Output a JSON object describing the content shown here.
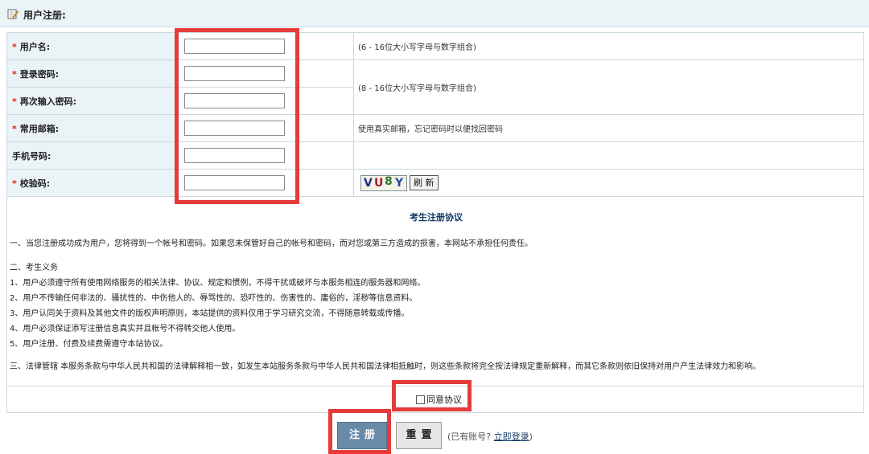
{
  "header": {
    "title": "用户注册:",
    "icon": "edit-icon"
  },
  "form": {
    "username": {
      "label": "用户名:",
      "required": true,
      "value": "",
      "hint": "(6 - 16位大小写字母与数字组合)"
    },
    "password": {
      "label": "登录密码:",
      "required": true,
      "value": "",
      "hint": "(8 - 16位大小写字母与数字组合)"
    },
    "password_confirm": {
      "label": "再次输入密码:",
      "required": true,
      "value": ""
    },
    "email": {
      "label": "常用邮箱:",
      "required": true,
      "value": "",
      "hint": "使用真实邮箱，忘记密码时以便找回密码"
    },
    "phone": {
      "label": "手机号码:",
      "required": false,
      "value": ""
    },
    "captcha": {
      "label": "校验码:",
      "required": true,
      "value": "",
      "image_text": "VU8Y",
      "refresh_label": "刷 新"
    },
    "required_mark": "*"
  },
  "agreement": {
    "title": "考生注册协议",
    "para1": "一、当您注册成功成为用户，您将得到一个帐号和密码。如果您未保管好自己的帐号和密码，而对您或第三方造成的损害，本网站不承担任何责任。",
    "section2_title": "二、考生义务",
    "items": [
      "1、用户必须遵守所有使用网络服务的相关法律、协议、规定和惯例，不得干扰或破坏与本服务相连的服务器和网络。",
      "2、用户不传输任何非法的、骚扰性的、中伤他人的、辱骂性的、恐吓性的、伤害性的、庸俗的，淫秽等信息资料。",
      "3、用户认同关于资料及其他文件的版权声明原则，本站提供的资料仅用于学习研究交流，不得随意转载或传播。",
      "4、用户必须保证添写注册信息真实并且帐号不得转交他人使用。",
      "5、用户注册、付费及续费需遵守本站协议。"
    ],
    "para3": "三、法律管辖 本服务条款与中华人民共和国的法律解释相一致，如发生本站服务条款与中华人民共和国法律相抵触时，则这些条款将完全按法律规定重新解释，而其它条款则依旧保持对用户产生法律效力和影响。"
  },
  "agree": {
    "label": "同意协议",
    "checked": false
  },
  "actions": {
    "register_label": "注册",
    "reset_label": "重置",
    "login_prompt": "(已有账号? ",
    "login_link": "立即登录",
    "login_suffix": ")"
  },
  "colors": {
    "highlight": "#e53b3b",
    "label_bg": "#eaf3f6",
    "register_bg": "#6a8aa9",
    "title_blue": "#123a69",
    "required_red": "#d0271d"
  }
}
